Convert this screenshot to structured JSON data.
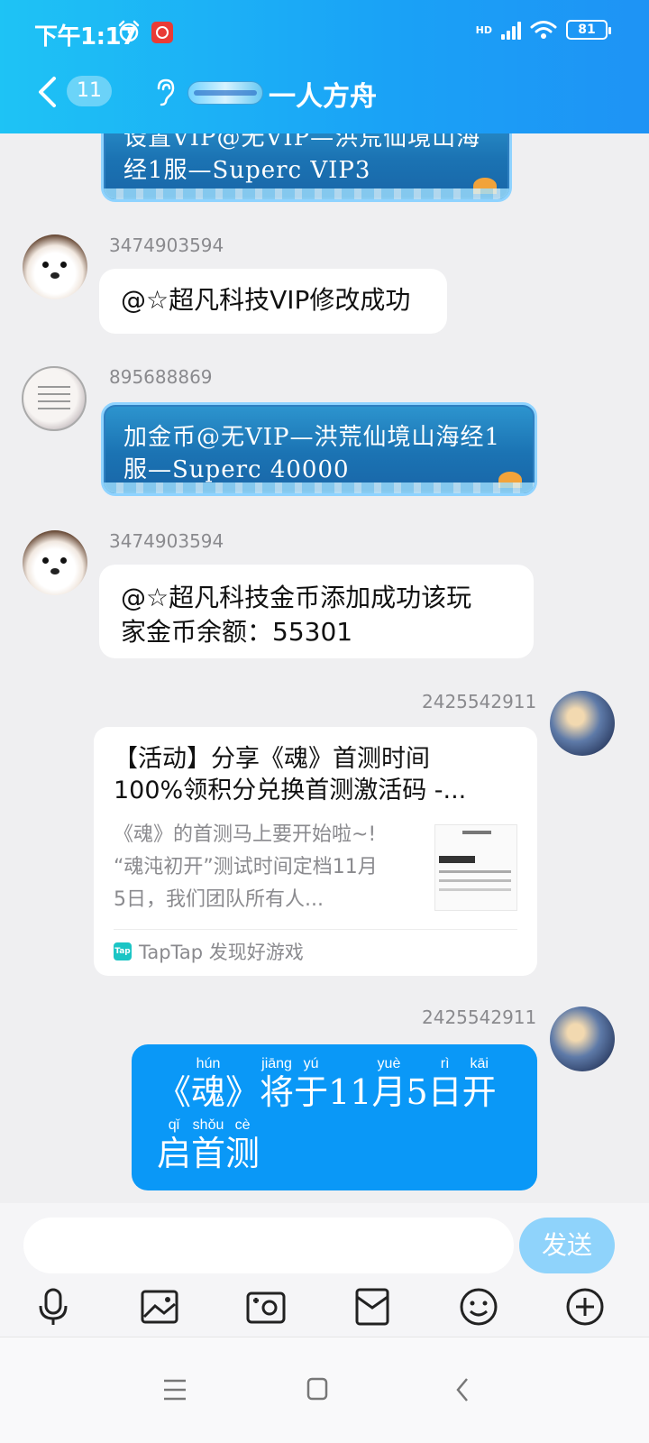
{
  "status_bar": {
    "time": "下午1:17",
    "network": "HD",
    "battery": "81"
  },
  "header": {
    "badge_count": "11",
    "title": "一人方舟"
  },
  "messages": {
    "m1": {
      "lines": [
        "设置VIP@无VIP—洪荒仙境山海",
        "经1服—Superc VIP3"
      ]
    },
    "m2": {
      "sender": "3474903594",
      "text": "@☆超凡科技VIP修改成功"
    },
    "m3": {
      "sender": "895688869",
      "lines": [
        "加金币@无VIP—洪荒仙境山海经1",
        "服—Superc 40000"
      ]
    },
    "m4": {
      "sender": "3474903594",
      "lines": [
        "@☆超凡科技金币添加成功该玩",
        "家金币余额：55301"
      ]
    },
    "m5": {
      "sender": "2425542911",
      "card": {
        "title_line1": "【活动】分享《魂》首测时间",
        "title_line2": "100%领积分兑换首测激活码 -...",
        "desc_line1": "《魂》的首测马上要开始啦~!",
        "desc_line2": "“魂沌初开”测试时间定档11月",
        "desc_line3": "5日，我们团队所有人...",
        "source_icon_text": "Tap",
        "source": "TapTap 发现好游戏"
      }
    },
    "m6": {
      "sender": "2425542911",
      "line1": [
        {
          "hz": "《",
          "py": ""
        },
        {
          "hz": "魂",
          "py": "hún"
        },
        {
          "hz": "》",
          "py": ""
        },
        {
          "hz": "将",
          "py": "jiāng"
        },
        {
          "hz": "于",
          "py": "yú"
        },
        {
          "hz": "11",
          "py": ""
        },
        {
          "hz": "月",
          "py": "yuè"
        },
        {
          "hz": "5",
          "py": ""
        },
        {
          "hz": "日",
          "py": "rì"
        },
        {
          "hz": "开",
          "py": "kāi"
        }
      ],
      "line2": [
        {
          "hz": "启",
          "py": "qǐ"
        },
        {
          "hz": "首",
          "py": "shǒu"
        },
        {
          "hz": "测",
          "py": "cè"
        }
      ]
    }
  },
  "composer": {
    "placeholder": "",
    "send_label": "发送"
  },
  "icons": {
    "toolbar": [
      "microphone-icon",
      "image-icon",
      "camera-icon",
      "red-packet-icon",
      "emoji-icon",
      "plus-icon"
    ],
    "nav": [
      "menu-icon",
      "home-icon",
      "back-icon"
    ]
  },
  "colors": {
    "header_gradient_start": "#1ec3f5",
    "header_gradient_end": "#1e93f5",
    "send_button": "#8fd3fb",
    "self_bubble": "#0a98f7",
    "chat_background": "#efeff1"
  }
}
